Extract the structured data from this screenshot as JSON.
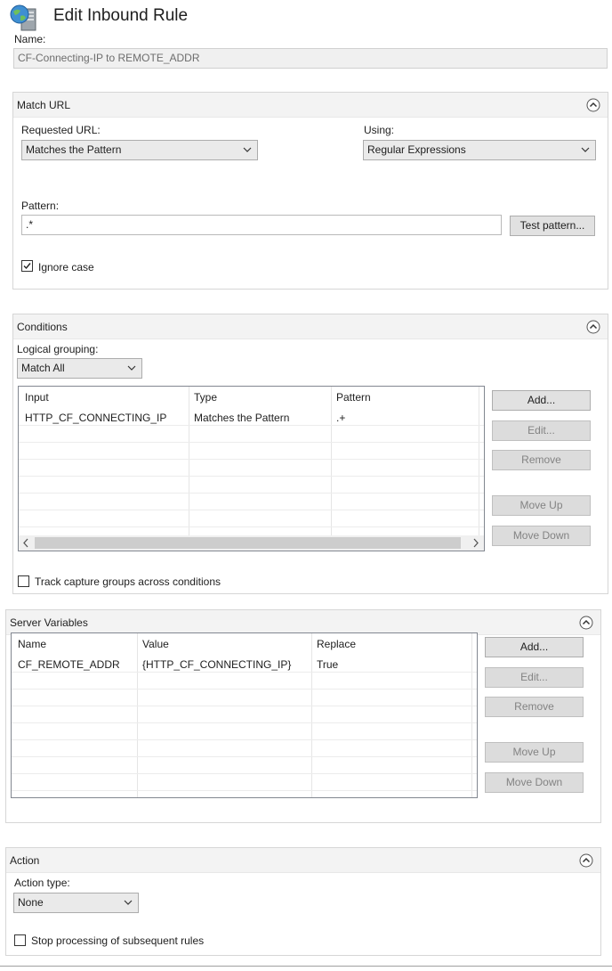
{
  "header": {
    "title": "Edit Inbound Rule",
    "icon": "globe-server-icon"
  },
  "name": {
    "label": "Name:",
    "value": "CF-Connecting-IP to REMOTE_ADDR"
  },
  "match_url": {
    "title": "Match URL",
    "requested_url_label": "Requested URL:",
    "requested_url_value": "Matches the Pattern",
    "using_label": "Using:",
    "using_value": "Regular Expressions",
    "pattern_label": "Pattern:",
    "pattern_value": ".*",
    "test_pattern_button": "Test pattern...",
    "ignore_case_label": "Ignore case",
    "ignore_case_checked": true
  },
  "conditions": {
    "title": "Conditions",
    "logical_grouping_label": "Logical grouping:",
    "logical_grouping_value": "Match All",
    "columns": [
      "Input",
      "Type",
      "Pattern"
    ],
    "rows": [
      {
        "input": "HTTP_CF_CONNECTING_IP",
        "type": "Matches the Pattern",
        "pattern": ".+"
      }
    ],
    "buttons": {
      "add": "Add...",
      "edit": "Edit...",
      "remove": "Remove",
      "move_up": "Move Up",
      "move_down": "Move Down"
    },
    "track_capture_label": "Track capture groups across conditions",
    "track_capture_checked": false
  },
  "server_variables": {
    "title": "Server Variables",
    "columns": [
      "Name",
      "Value",
      "Replace"
    ],
    "rows": [
      {
        "name": "CF_REMOTE_ADDR",
        "value": "{HTTP_CF_CONNECTING_IP}",
        "replace": "True"
      }
    ],
    "buttons": {
      "add": "Add...",
      "edit": "Edit...",
      "remove": "Remove",
      "move_up": "Move Up",
      "move_down": "Move Down"
    }
  },
  "action": {
    "title": "Action",
    "action_type_label": "Action type:",
    "action_type_value": "None",
    "stop_processing_label": "Stop processing of subsequent rules",
    "stop_processing_checked": false
  }
}
